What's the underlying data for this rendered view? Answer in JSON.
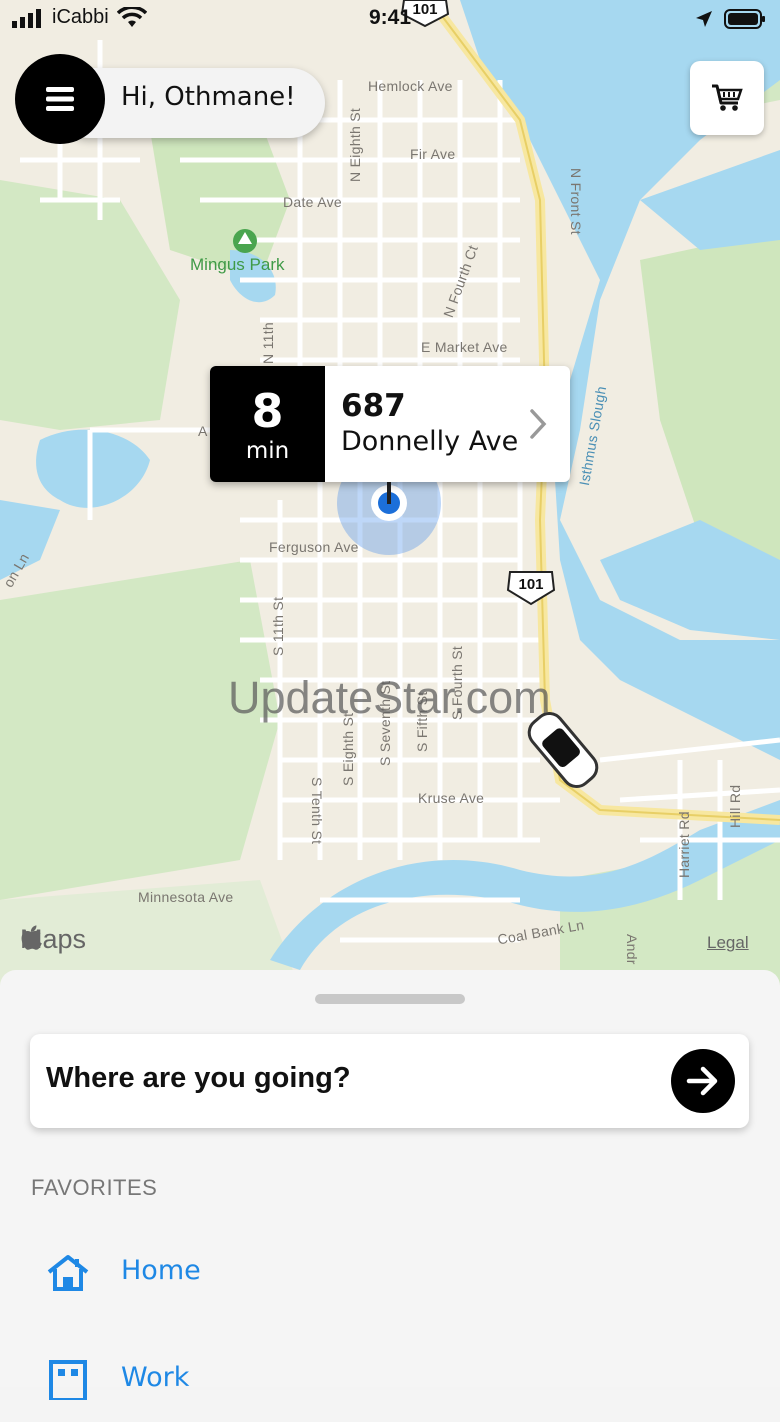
{
  "status_bar": {
    "carrier": "iCabbi",
    "time": "9:41"
  },
  "header": {
    "greeting": "Hi, Othmane!",
    "menu_icon": "hamburger-icon",
    "cart_icon": "cart-icon"
  },
  "map": {
    "streets": [
      "Hemlock Ave",
      "Fir Ave",
      "Date Ave",
      "E Market Ave",
      "Ferguson Ave",
      "Kruse Ave",
      "Minnesota Ave",
      "Coal Bank Ln",
      "N Eighth St",
      "N Front St",
      "N Fourth Ct",
      "N 11th",
      "S 11th St",
      "S Eighth St",
      "S Seventh St",
      "S Fifth St",
      "S Fourth St",
      "S Tenth St",
      "Harriet Rd",
      "Hill Rd",
      "Isthmus Slough",
      "Andr",
      "A",
      "on Ln"
    ],
    "park": "Mingus Park",
    "highway": "101",
    "highway_top": "101",
    "watermark": "UpdateStar.com",
    "attribution": "Maps",
    "legal": "Legal"
  },
  "eta_card": {
    "minutes": "8",
    "unit": "min",
    "address_number": "687",
    "address_street": "Donnelly Ave"
  },
  "sheet": {
    "search_placeholder": "Where are you going?",
    "favorites_title": "FAVORITES",
    "favorites": [
      {
        "label": "Home",
        "icon": "home-icon"
      },
      {
        "label": "Work",
        "icon": "work-icon"
      }
    ]
  },
  "colors": {
    "water": "#a6d8f0",
    "park": "#c9e6ba",
    "land": "#f1ede2",
    "road": "#ffffff",
    "highway": "#f7e7a0",
    "favorite_link": "#1e88e5",
    "location_dot": "#1c6fd9"
  }
}
